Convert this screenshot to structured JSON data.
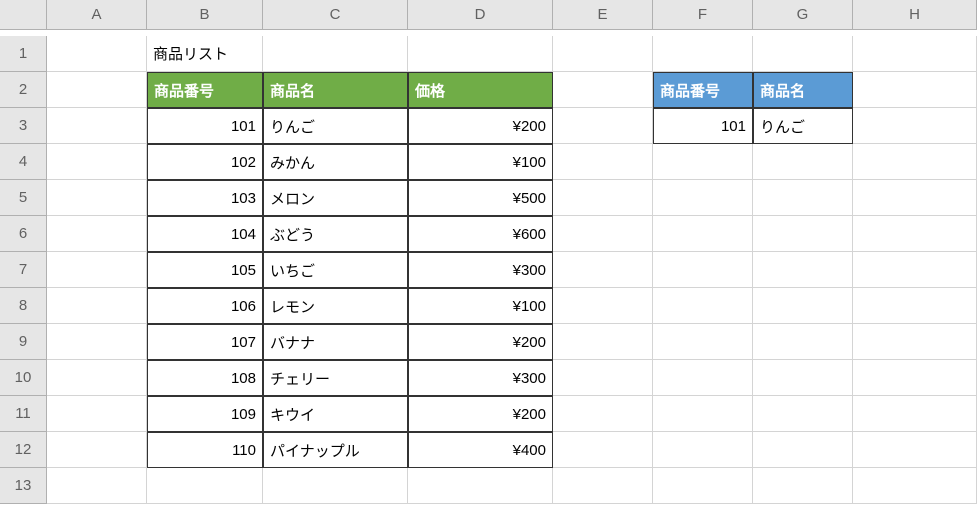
{
  "columns": [
    "A",
    "B",
    "C",
    "D",
    "E",
    "F",
    "G",
    "H"
  ],
  "rows": [
    "1",
    "2",
    "3",
    "4",
    "5",
    "6",
    "7",
    "8",
    "9",
    "10",
    "11",
    "12",
    "13"
  ],
  "title_cell": "商品リスト",
  "table1": {
    "headers": [
      "商品番号",
      "商品名",
      "価格"
    ],
    "data": [
      {
        "id": "101",
        "name": "りんご",
        "price": "¥200"
      },
      {
        "id": "102",
        "name": "みかん",
        "price": "¥100"
      },
      {
        "id": "103",
        "name": "メロン",
        "price": "¥500"
      },
      {
        "id": "104",
        "name": "ぶどう",
        "price": "¥600"
      },
      {
        "id": "105",
        "name": "いちご",
        "price": "¥300"
      },
      {
        "id": "106",
        "name": "レモン",
        "price": "¥100"
      },
      {
        "id": "107",
        "name": "バナナ",
        "price": "¥200"
      },
      {
        "id": "108",
        "name": "チェリー",
        "price": "¥300"
      },
      {
        "id": "109",
        "name": "キウイ",
        "price": "¥200"
      },
      {
        "id": "110",
        "name": "パイナップル",
        "price": "¥400"
      }
    ]
  },
  "table2": {
    "headers": [
      "商品番号",
      "商品名"
    ],
    "data": [
      {
        "id": "101",
        "name": "りんご"
      }
    ]
  },
  "chart_data": {
    "type": "table",
    "title": "商品リスト",
    "tables": [
      {
        "columns": [
          "商品番号",
          "商品名",
          "価格"
        ],
        "rows": [
          [
            101,
            "りんご",
            200
          ],
          [
            102,
            "みかん",
            100
          ],
          [
            103,
            "メロン",
            500
          ],
          [
            104,
            "ぶどう",
            600
          ],
          [
            105,
            "いちご",
            300
          ],
          [
            106,
            "レモン",
            100
          ],
          [
            107,
            "バナナ",
            200
          ],
          [
            108,
            "チェリー",
            300
          ],
          [
            109,
            "キウイ",
            200
          ],
          [
            110,
            "パイナップル",
            400
          ]
        ]
      },
      {
        "columns": [
          "商品番号",
          "商品名"
        ],
        "rows": [
          [
            101,
            "りんご"
          ]
        ]
      }
    ]
  }
}
